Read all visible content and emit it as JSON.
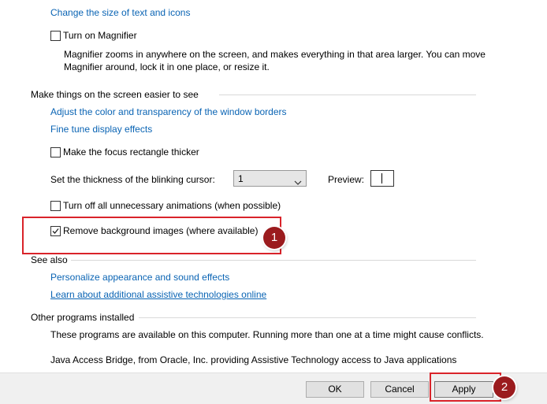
{
  "top": {
    "change_text_size_link": "Change the size of text and icons",
    "magnifier_checkbox_label": "Turn on Magnifier",
    "magnifier_checked": false,
    "magnifier_desc_line1": "Magnifier zooms in anywhere on the screen, and makes everything in that area larger. You can move",
    "magnifier_desc_line2": "Magnifier around, lock it in one place, or resize it."
  },
  "easier_to_see": {
    "heading": "Make things on the screen easier to see",
    "adjust_borders_link": "Adjust the color and transparency of the window borders",
    "fine_tune_link": "Fine tune display effects",
    "focus_rect_label": "Make the focus rectangle thicker",
    "focus_rect_checked": false,
    "cursor_thickness_label": "Set the thickness of the blinking cursor:",
    "cursor_thickness_value": "1",
    "preview_label": "Preview:",
    "animations_label": "Turn off all unnecessary animations (when possible)",
    "animations_checked": false,
    "remove_bg_label": "Remove background images (where available)",
    "remove_bg_checked": true
  },
  "see_also": {
    "heading": "See also",
    "personalize_link": "Personalize appearance and sound effects",
    "learn_more_link": "Learn about additional assistive technologies online"
  },
  "other_programs": {
    "heading": "Other programs installed",
    "description": "These programs are available on this computer. Running more than one at a time might cause conflicts.",
    "program_1": "Java Access Bridge, from Oracle, Inc. providing Assistive Technology access to Java applications"
  },
  "buttons": {
    "ok_label": "OK",
    "cancel_label": "Cancel",
    "apply_label": "Apply"
  },
  "annotations": {
    "step_1": "1",
    "step_2": "2",
    "highlight_color": "#d9232a",
    "badge_color": "#9b1b1e"
  },
  "colors": {
    "link": "#0a64b4",
    "bottom_bar": "#f0f0f0",
    "button_face": "#e1e1e1"
  }
}
